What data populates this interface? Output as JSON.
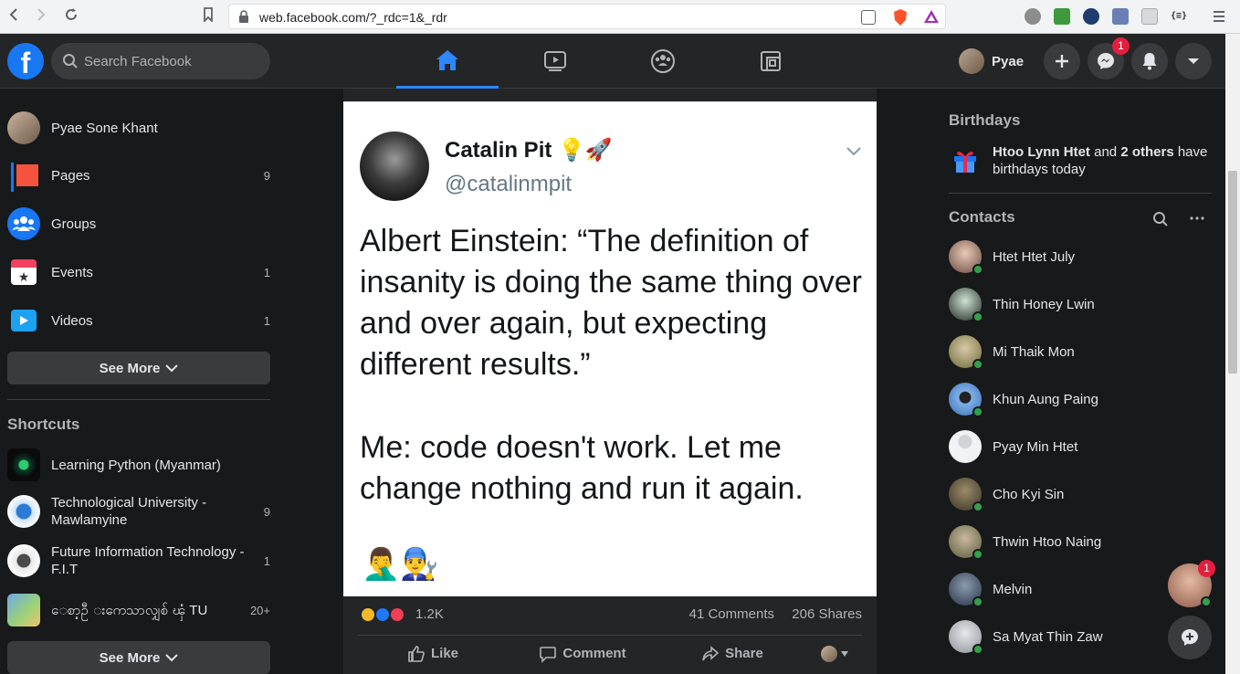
{
  "browser": {
    "url": "web.facebook.com/?_rdc=1&_rdr"
  },
  "header": {
    "logo": "f",
    "search_placeholder": "Search Facebook",
    "user_name": "Pyae",
    "messenger_badge": "1"
  },
  "left": {
    "items": [
      {
        "label": "Pyae Sone Khant",
        "count": ""
      },
      {
        "label": "Pages",
        "count": "9"
      },
      {
        "label": "Groups",
        "count": ""
      },
      {
        "label": "Events",
        "count": "1"
      },
      {
        "label": "Videos",
        "count": "1"
      }
    ],
    "see_more": "See More",
    "shortcuts_title": "Shortcuts",
    "shortcuts": [
      {
        "label": "Learning Python (Myanmar)",
        "count": ""
      },
      {
        "label": "Technological University - Mawlamyine",
        "count": "9"
      },
      {
        "label": "Future Information Technology - F.I.T",
        "count": "1"
      },
      {
        "label": "ေစာ့ဦ းကေသာလျှစ် ၾံ TU",
        "count": "20+"
      }
    ],
    "see_more_2": "See More"
  },
  "post": {
    "tweet_name": "Catalin Pit 💡🚀",
    "tweet_handle": "@catalinmpit",
    "tweet_text_1": "Albert Einstein: “The definition of insanity is doing the same thing over and over again, but expecting different results.”",
    "tweet_text_2": "Me: code doesn't work. Let me change nothing and run it again.",
    "tweet_emoji": "🤦‍♂️👨‍🔧",
    "reactions_count": "1.2K",
    "comments": "41 Comments",
    "shares": "206 Shares",
    "like_label": "Like",
    "comment_label": "Comment",
    "share_label": "Share"
  },
  "right": {
    "birthdays_title": "Birthdays",
    "birthday_name": "Htoo Lynn Htet",
    "birthday_and": " and ",
    "birthday_others": "2 others",
    "birthday_rest": " have birthdays today",
    "contacts_title": "Contacts",
    "contacts": [
      "Htet Htet July",
      "Thin Honey Lwin",
      "Mi Thaik Mon",
      "Khun Aung Paing",
      "Pyay Min Htet",
      "Cho Kyi Sin",
      "Thwin Htoo Naing",
      "Melvin",
      "Sa Myat Thin Zaw"
    ],
    "chat_badge": "1"
  },
  "colors": {
    "accent": "#2d88ff",
    "badge": "#e41e3f",
    "online": "#31a24c"
  }
}
